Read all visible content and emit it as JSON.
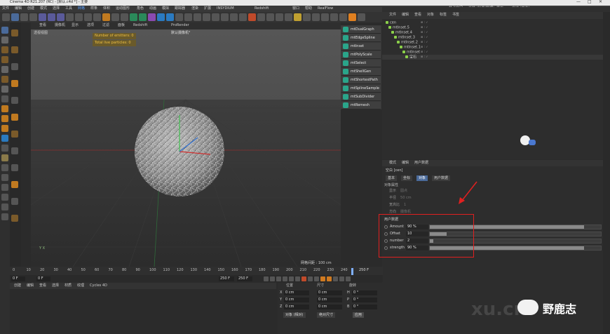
{
  "window": {
    "title": "Cinema 4D R21.207 (RC) - [默认.c4d *] - 主要",
    "controls": [
      "—",
      "□",
      "✕"
    ]
  },
  "menu": {
    "items": [
      "文件",
      "编辑",
      "创建",
      "模式",
      "选择",
      "工具",
      "网格",
      "样条",
      "体积",
      "运动图形",
      "角色",
      "动画",
      "模拟",
      "跟踪器",
      "渲染",
      "扩展",
      "INSYDIUM",
      "Redshift",
      "窗口",
      "帮助",
      "RealFlow"
    ],
    "active_index": 6,
    "right_items": [
      "节点空间:",
      "当前 (标准/物理)",
      "界面:",
      "启动 (用户)"
    ]
  },
  "viewport": {
    "menu": [
      "查看",
      "摄像机",
      "显示",
      "选项",
      "过滤",
      "面板",
      "Redshift",
      "ProRender"
    ],
    "label": "透视视图",
    "camera": "默认摄像机°",
    "hud": [
      "Number of emitters: 0",
      "Total live particles: 0"
    ],
    "grid_info": "网格间距 : 100 cm",
    "axes_label": "Y  X"
  },
  "palette": {
    "items": [
      "mtDualGraph",
      "mtEdgeSpline",
      "mtInset",
      "mtPolyScale",
      "mtSelect",
      "mtShellGen",
      "mtShortestPath",
      "mtSplineSample",
      "mtSubDivider",
      "mtRemesh"
    ]
  },
  "object_manager": {
    "menu": [
      "文件",
      "编辑",
      "查看",
      "对象",
      "标签",
      "书签"
    ],
    "rows": [
      {
        "name": "cen",
        "indent": 0
      },
      {
        "name": "mtInset.5",
        "indent": 1
      },
      {
        "name": "mtInset.4",
        "indent": 2
      },
      {
        "name": "mtInset.3",
        "indent": 3
      },
      {
        "name": "mtInset.2",
        "indent": 4
      },
      {
        "name": "mtInset.1",
        "indent": 5
      },
      {
        "name": "mtInset",
        "indent": 6
      },
      {
        "name": "宝石",
        "indent": 7
      }
    ],
    "flags": "⊞ : ✓"
  },
  "attributes": {
    "menu": [
      "模式",
      "编辑",
      "用户数据"
    ],
    "title": "空白 [cen]",
    "tabs": [
      "基本",
      "坐标",
      "对象",
      "用户数据"
    ],
    "selected_tab_index": 2,
    "section_title": "对象属性",
    "props": [
      {
        "label": "显示",
        "value": "圆点"
      },
      {
        "label": "半径",
        "value": "50 cm"
      },
      {
        "label": "宽高比",
        "value": "1"
      },
      {
        "label": "方向",
        "value": "摄像机"
      }
    ],
    "user_data_title": "用户数据",
    "user_data": [
      {
        "label": "Amount",
        "value": "90 %",
        "fraction": 0.9
      },
      {
        "label": "Offset",
        "value": "10",
        "fraction": 0.1
      },
      {
        "label": "number",
        "value": "2",
        "fraction": 0.02
      },
      {
        "label": "strength",
        "value": "90 %",
        "fraction": 0.9
      }
    ]
  },
  "timeline": {
    "ticks": [
      "0",
      "10",
      "20",
      "30",
      "40",
      "50",
      "60",
      "70",
      "80",
      "90",
      "100",
      "110",
      "120",
      "130",
      "140",
      "150",
      "160",
      "170",
      "180",
      "190",
      "200",
      "210",
      "220",
      "230",
      "240"
    ],
    "end_label": "250 F",
    "current_frame": "0 F",
    "start_field": "0 F",
    "end_field": "250 F",
    "end_field2": "250 F"
  },
  "materials": {
    "menu": [
      "创建",
      "编辑",
      "查看",
      "选择",
      "材质",
      "纹理",
      "Cycles 4D"
    ]
  },
  "coordinates": {
    "headers": [
      "位置",
      "尺寸",
      "旋转"
    ],
    "rows": [
      {
        "axis": "X",
        "pos": "0 cm",
        "size": "0 cm",
        "rot_axis": "H",
        "rot": "0 °"
      },
      {
        "axis": "Y",
        "pos": "0 cm",
        "size": "0 cm",
        "rot_axis": "P",
        "rot": "0 °"
      },
      {
        "axis": "Z",
        "pos": "0 cm",
        "size": "0 cm",
        "rot_axis": "B",
        "rot": "0 °"
      }
    ],
    "mode_select": "对象 (相对)",
    "size_select": "绝对尺寸",
    "apply": "应用"
  },
  "watermark": {
    "text": "野鹿志",
    "ghost": "xu.cn"
  },
  "colors": {
    "accent": "#4a6a9a",
    "highlight_box": "#e02020",
    "plugin_icon": "#2aa58a",
    "hud_text": "#f0c040"
  }
}
